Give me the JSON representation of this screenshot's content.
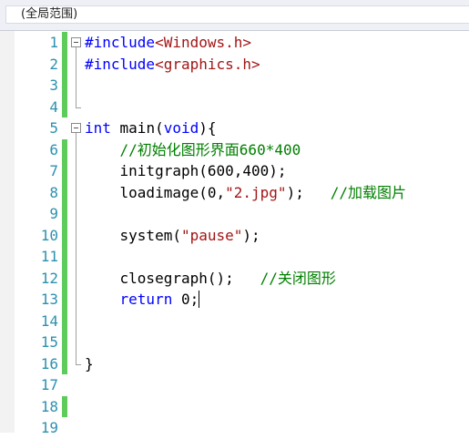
{
  "scope_selector": {
    "value": "(全局范围)"
  },
  "colors": {
    "keyword": "#0000ff",
    "string": "#a31515",
    "comment": "#008000",
    "line_number": "#2b91af",
    "changed_bar": "#5dcc5d"
  },
  "lines": [
    {
      "n": "1",
      "tokens": [
        {
          "t": "#include",
          "c": "kw"
        },
        {
          "t": "<Windows.h>",
          "c": "str"
        }
      ]
    },
    {
      "n": "2",
      "tokens": [
        {
          "t": "#include",
          "c": "kw"
        },
        {
          "t": "<graphics.h>",
          "c": "str"
        }
      ]
    },
    {
      "n": "3",
      "tokens": []
    },
    {
      "n": "4",
      "tokens": []
    },
    {
      "n": "5",
      "tokens": [
        {
          "t": "int",
          "c": "kw"
        },
        {
          "t": " main(",
          "c": "plain"
        },
        {
          "t": "void",
          "c": "kw"
        },
        {
          "t": "){",
          "c": "plain"
        }
      ]
    },
    {
      "n": "6",
      "tokens": [
        {
          "t": "    //初始化图形界面660*400",
          "c": "cmt"
        }
      ]
    },
    {
      "n": "7",
      "tokens": [
        {
          "t": "    initgraph(600,400);",
          "c": "plain"
        }
      ]
    },
    {
      "n": "8",
      "tokens": [
        {
          "t": "    loadimage(0,",
          "c": "plain"
        },
        {
          "t": "\"2.jpg\"",
          "c": "str"
        },
        {
          "t": ");   ",
          "c": "plain"
        },
        {
          "t": "//加载图片",
          "c": "cmt"
        }
      ]
    },
    {
      "n": "9",
      "tokens": []
    },
    {
      "n": "10",
      "tokens": [
        {
          "t": "    system(",
          "c": "plain"
        },
        {
          "t": "\"pause\"",
          "c": "str"
        },
        {
          "t": ");",
          "c": "plain"
        }
      ]
    },
    {
      "n": "11",
      "tokens": []
    },
    {
      "n": "12",
      "tokens": [
        {
          "t": "    closegraph();   ",
          "c": "plain"
        },
        {
          "t": "//关闭图形",
          "c": "cmt"
        }
      ]
    },
    {
      "n": "13",
      "tokens": [
        {
          "t": "    return",
          "c": "kw"
        },
        {
          "t": " 0;",
          "c": "plain"
        }
      ]
    },
    {
      "n": "14",
      "tokens": []
    },
    {
      "n": "15",
      "tokens": []
    },
    {
      "n": "16",
      "tokens": [
        {
          "t": "}",
          "c": "plain"
        }
      ]
    },
    {
      "n": "17",
      "tokens": []
    },
    {
      "n": "18",
      "tokens": []
    },
    {
      "n": "19",
      "tokens": []
    }
  ],
  "changed_lines": [
    "1",
    "2",
    "3",
    "4",
    "6",
    "7",
    "8",
    "9",
    "10",
    "11",
    "12",
    "13",
    "14",
    "15",
    "16",
    "18"
  ],
  "caret_line": "13"
}
